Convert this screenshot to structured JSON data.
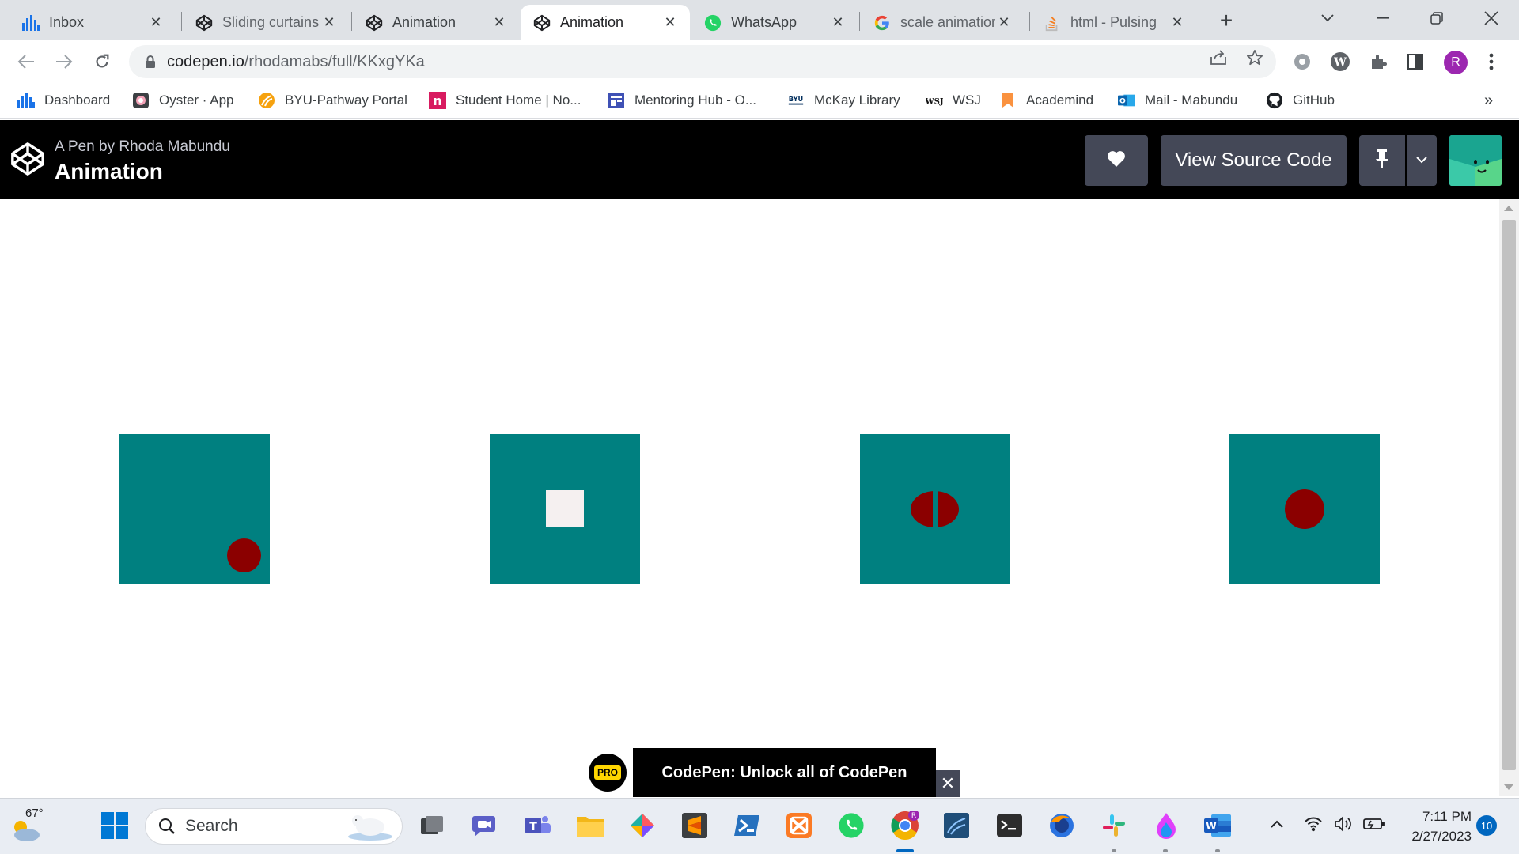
{
  "browser": {
    "tabs": [
      {
        "title": "Inbox",
        "icon": "bars-chart-icon"
      },
      {
        "title": "Sliding curtains",
        "icon": "codepen-icon"
      },
      {
        "title": "Animation",
        "icon": "codepen-icon"
      },
      {
        "title": "Animation",
        "icon": "codepen-icon",
        "active": true
      },
      {
        "title": "WhatsApp",
        "icon": "whatsapp-icon"
      },
      {
        "title": "scale animation",
        "icon": "google-icon"
      },
      {
        "title": "html - Pulsing",
        "icon": "stackoverflow-icon"
      }
    ],
    "url_host": "codepen.io",
    "url_path": "/rhodamabs/full/KKxgYKa",
    "profile_initial": "R",
    "bookmarks": [
      {
        "label": "Dashboard"
      },
      {
        "label": "Oyster · App"
      },
      {
        "label": "BYU-Pathway Portal"
      },
      {
        "label": "Student Home | No..."
      },
      {
        "label": "Mentoring Hub - O..."
      },
      {
        "label": "McKay Library"
      },
      {
        "label": "WSJ"
      },
      {
        "label": "Academind"
      },
      {
        "label": "Mail - Mabundu"
      },
      {
        "label": "GitHub"
      }
    ],
    "bookmarks_more": "»"
  },
  "codepen": {
    "by_prefix": "A Pen by",
    "author": "Rhoda Mabundu",
    "title": "Animation",
    "view_source_label": "View Source Code"
  },
  "stage": {
    "box_color": "#008080",
    "accent_red": "#8b0000",
    "accent_light": "#f5f0f0"
  },
  "pro_banner": {
    "badge": "PRO",
    "text": "CodePen: Unlock all of CodePen",
    "close": "✕"
  },
  "taskbar": {
    "temperature": "67°",
    "search_label": "Search",
    "time": "7:11 PM",
    "date": "2/27/2023",
    "notifications": "10"
  }
}
